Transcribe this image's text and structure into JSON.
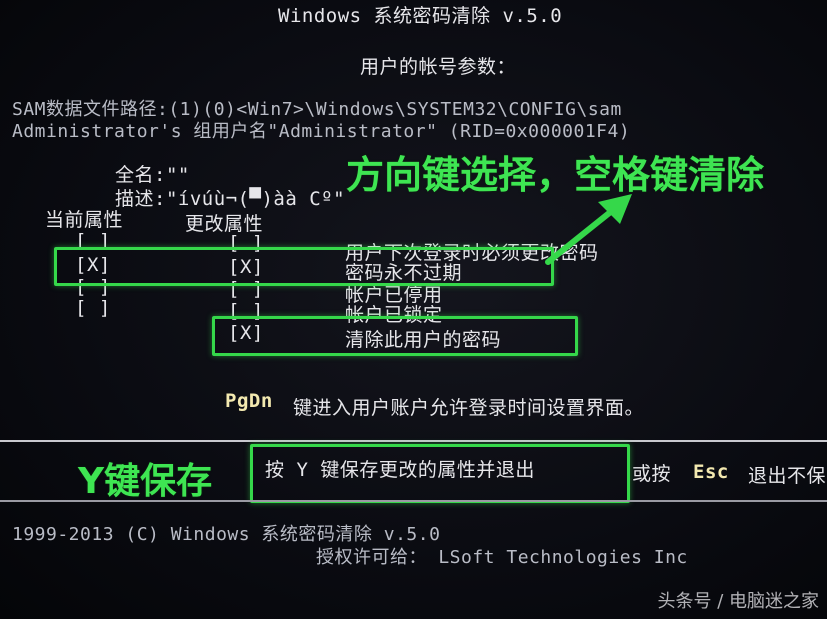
{
  "header": {
    "title": "Windows 系统密码清除 v.5.0",
    "subtitle": "用户的帐号参数："
  },
  "info": {
    "sam_path": "SAM数据文件路径:(1)(0)<Win7>\\Windows\\SYSTEM32\\CONFIG\\sam",
    "group_line": "Administrator's 组用户名\"Administrator\" (RID=0x000001F4)",
    "fullname": "全名:\"\"",
    "description": "描述:\"ívúù¬(▀)àà Cº\""
  },
  "columns": {
    "current": "当前属性",
    "change": "更改属性"
  },
  "attributes": [
    {
      "current": "[ ]",
      "change": "[ ]",
      "label": "用户下次登录时必须更改密码"
    },
    {
      "current": "[X]",
      "change": "[X]",
      "label": "密码永不过期"
    },
    {
      "current": "[ ]",
      "change": "[ ]",
      "label": "帐户已停用"
    },
    {
      "current": "[ ]",
      "change": "[ ]",
      "label": "帐户已锁定"
    },
    {
      "current": "",
      "change": "[X]",
      "label": "清除此用户的密码"
    }
  ],
  "pgdn": {
    "key": "PgDn",
    "text": "键进入用户账户允许登录时间设置界面。"
  },
  "footer_cmd": {
    "save": "按 Y 键保存更改的属性并退出",
    "or": "或按",
    "esc": "Esc",
    "exit": "退出不保"
  },
  "copyright": {
    "line1": "1999-2013 (C)  Windows 系统密码清除 v.5.0",
    "line2": "授权许可给： LSoft Technologies Inc"
  },
  "annotations": {
    "arrow_hint": "方向键选择，空格键清除",
    "save_hint": "Y键保存"
  },
  "watermark": "头条号 / 电脑迷之家",
  "colors": {
    "annotation": "#35d84a",
    "background": "#06070c"
  }
}
